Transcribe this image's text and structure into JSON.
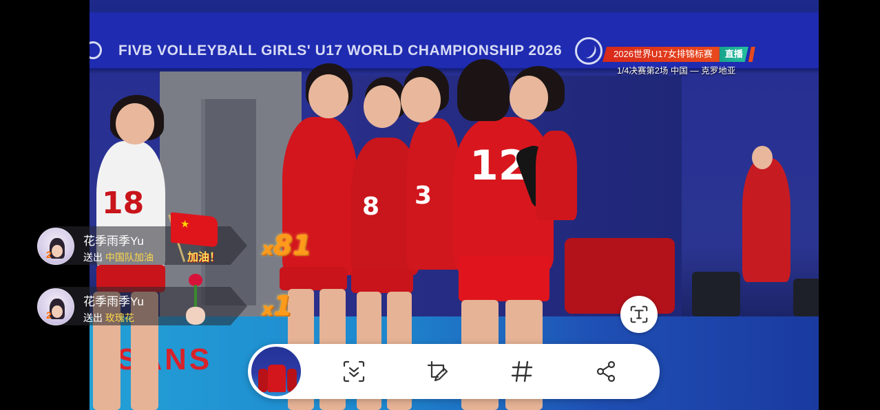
{
  "video": {
    "banner_text": "FIVB VOLLEYBALL GIRLS' U17 WORLD CHAMPIONSHIP 2026",
    "ad_text": "SANS",
    "jersey_numbers": [
      "18",
      "8",
      "3",
      "12"
    ]
  },
  "broadcast": {
    "event_title": "2026世界U17女排锦标赛",
    "live_label": "直播",
    "match_info": "1/4决赛第2场  中国 — 克罗地亚"
  },
  "gifts": [
    {
      "user": "花季雨季Yu",
      "action": "送出",
      "gift_name": "中国队加油",
      "gift_image_label": "加油！",
      "count": "81",
      "count_prefix": "x",
      "avatar_badge": "2"
    },
    {
      "user": "花季雨季Yu",
      "action": "送出",
      "gift_name": "玫瑰花",
      "count": "1",
      "count_prefix": "x",
      "avatar_badge": "2"
    }
  ],
  "toolbar": {
    "buttons": [
      "scroll-capture-icon",
      "edit-crop-icon",
      "hashtag-icon",
      "share-icon"
    ]
  },
  "overlay_button": {
    "icon": "text-recognition-icon"
  },
  "colors": {
    "live_red": "#d8281a",
    "live_green": "#17a38b",
    "gift_gold": "#ffd84a",
    "count_orange": "#ff9a1a"
  }
}
